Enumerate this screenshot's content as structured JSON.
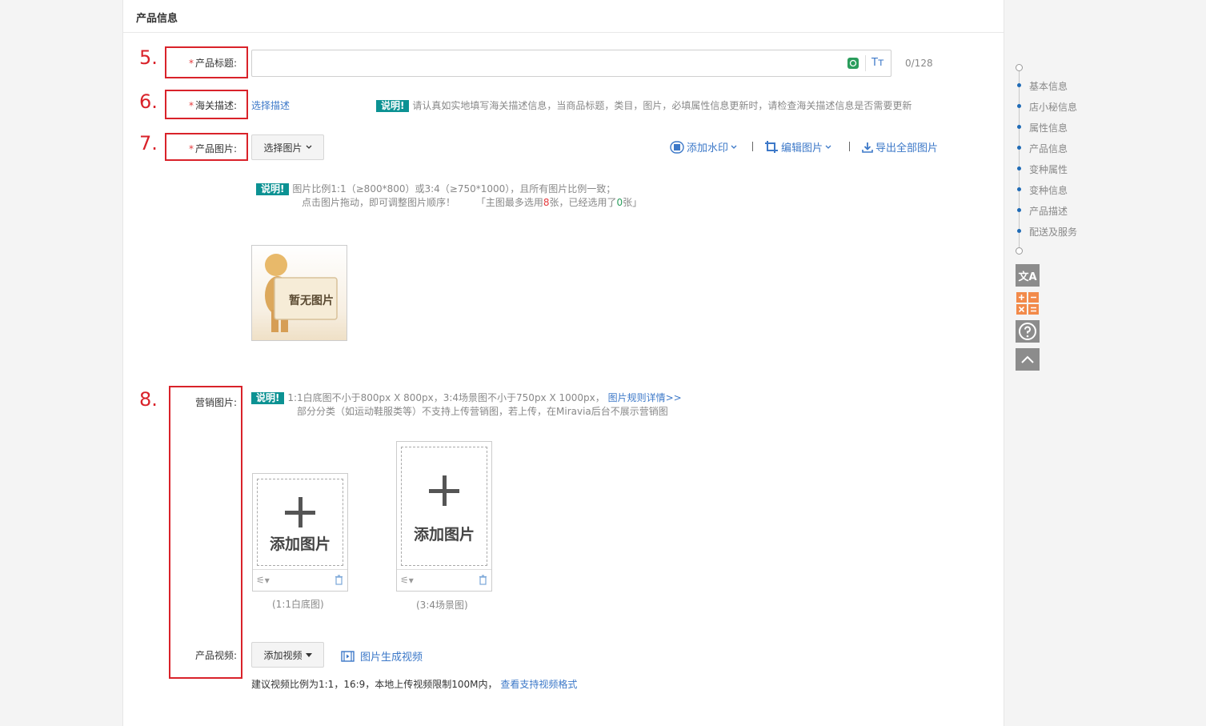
{
  "section_title": "产品信息",
  "steps": [
    "5.",
    "6.",
    "7.",
    "8."
  ],
  "title_field": {
    "label": "产品标题:",
    "value": "",
    "placeholder": "",
    "counter": "0/128",
    "tt_icon": "Tт"
  },
  "customs": {
    "label": "海关描述:",
    "link": "选择描述",
    "tip_badge": "说明!",
    "tip_text": "请认真如实地填写海关描述信息，当商品标题，类目，图片，必填属性信息更新时，请检查海关描述信息是否需要更新"
  },
  "images": {
    "label": "产品图片:",
    "select_btn": "选择图片",
    "watermark": "添加水印",
    "edit": "编辑图片",
    "export": "导出全部图片",
    "tip_badge": "说明!",
    "tip_line1": "图片比例1:1（≥800*800）或3:4（≥750*1000），且所有图片比例一致；",
    "tip_line2_a": "点击图片拖动，即可调整图片顺序！",
    "tip_line2_b": "「主图最多选用",
    "tip_max": "8",
    "tip_line2_c": "张，已经选用了",
    "tip_used": "0",
    "tip_line2_d": "张」",
    "placeholder_text": "暂无图片"
  },
  "marketing": {
    "label": "营销图片:",
    "tip_badge": "说明!",
    "tip_line1": "1:1白底图不小于800px X 800px，3:4场景图不小于750px X 1000px，",
    "tip_link": "图片规则详情>>",
    "tip_line2": "部分分类（如运动鞋服类等）不支持上传营销图，若上传，在Miravia后台不展示营销图",
    "card1_text": "添加图片",
    "card1_caption": "(1:1白底图)",
    "card2_text": "添加图片",
    "card2_caption": "(3:4场景图)"
  },
  "video": {
    "label": "产品视频:",
    "add_btn": "添加视频",
    "gen_link": "图片生成视频",
    "note": "建议视频比例为1:1，16:9，本地上传视频限制100M内，",
    "note_link": "查看支持视频格式"
  },
  "nav": {
    "items": [
      "基本信息",
      "店小秘信息",
      "属性信息",
      "产品信息",
      "变种属性",
      "变种信息",
      "产品描述",
      "配送及服务"
    ]
  },
  "side_tools": {
    "translate": "文A"
  },
  "colors": {
    "accent": "#3c78c8",
    "badge": "#0c9293",
    "red": "#d9222a",
    "nav_dot": "#1f6bb6"
  }
}
